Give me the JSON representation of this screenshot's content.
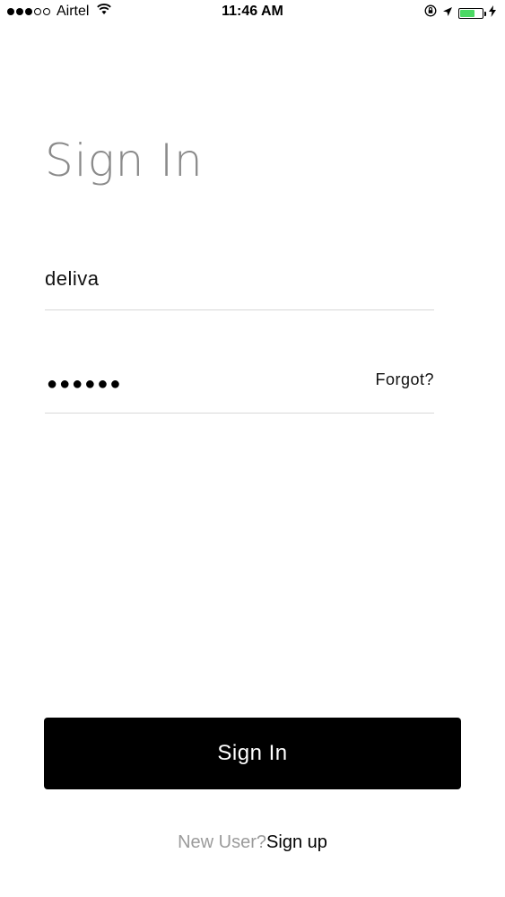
{
  "status_bar": {
    "carrier": "Airtel",
    "time": "11:46 AM",
    "battery_color": "#4cd964"
  },
  "page": {
    "title": "Sign In"
  },
  "form": {
    "username_value": "deliva",
    "password_masked": "●●●●●●",
    "forgot_label": "Forgot?"
  },
  "actions": {
    "signin_label": "Sign In",
    "new_user_label": "New User?",
    "signup_label": "Sign up"
  },
  "icons": [
    "wifi-icon",
    "orientation-lock-icon",
    "location-arrow-icon",
    "battery-icon",
    "charging-bolt-icon"
  ]
}
